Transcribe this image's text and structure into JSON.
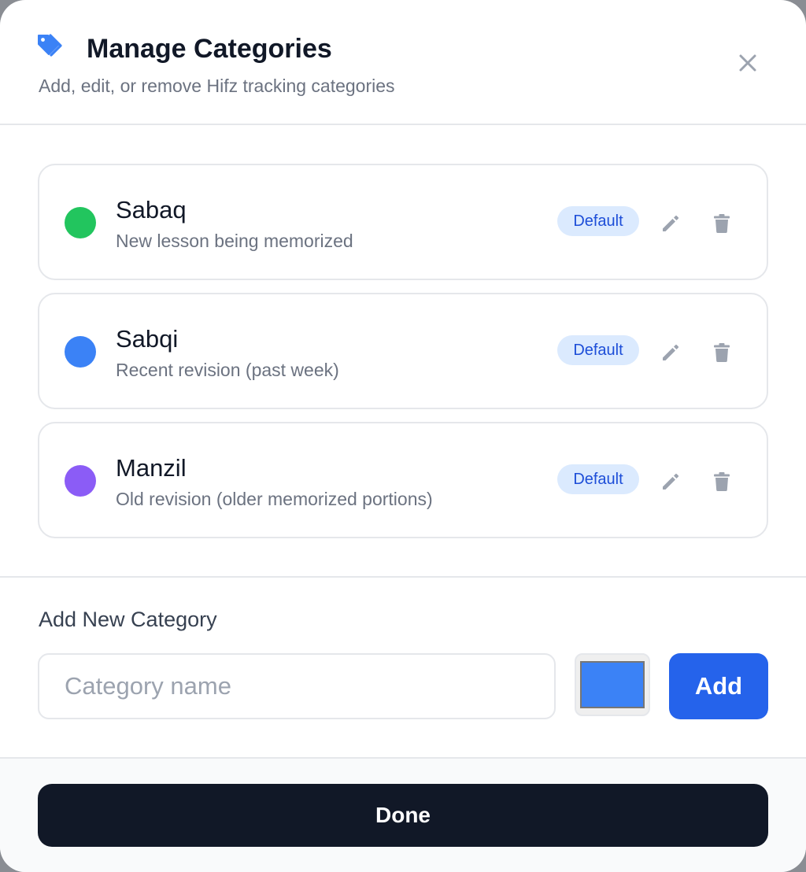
{
  "modal": {
    "title": "Manage Categories",
    "subtitle": "Add, edit, or remove Hifz tracking categories",
    "title_icon": "tags-icon",
    "close_icon": "close-icon"
  },
  "categories": [
    {
      "name": "Sabaq",
      "description": "New lesson being memorized",
      "color": "#22c55e",
      "badge": "Default"
    },
    {
      "name": "Sabqi",
      "description": "Recent revision (past week)",
      "color": "#3b82f6",
      "badge": "Default"
    },
    {
      "name": "Manzil",
      "description": "Old revision (older memorized portions)",
      "color": "#8b5cf6",
      "badge": "Default"
    }
  ],
  "item_actions": {
    "edit_icon": "pencil-icon",
    "delete_icon": "trash-icon"
  },
  "add_section": {
    "heading": "Add New Category",
    "name_placeholder": "Category name",
    "name_value": "",
    "selected_color": "#3b82f6",
    "add_label": "Add"
  },
  "footer": {
    "done_label": "Done"
  },
  "colors": {
    "accent": "#2563eb",
    "badge_bg": "#dbeafe",
    "badge_text": "#1d4ed8",
    "done_bg": "#111827"
  }
}
